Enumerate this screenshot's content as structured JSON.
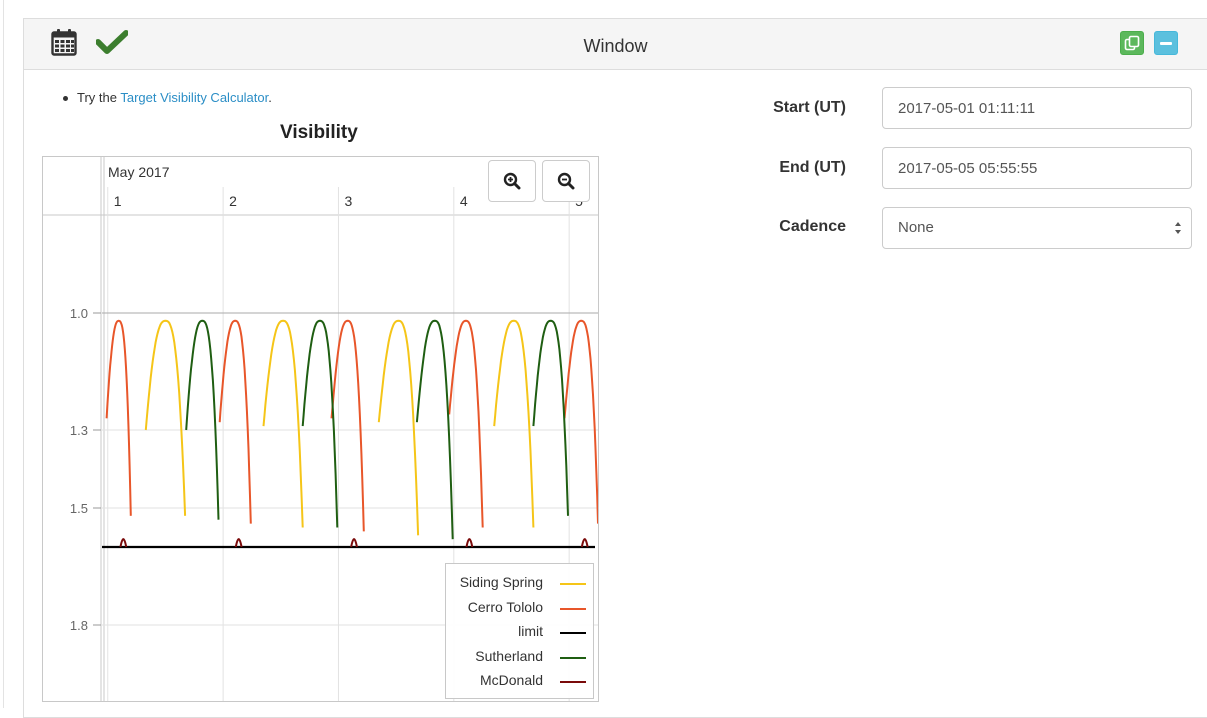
{
  "panel": {
    "title": "Window",
    "icons": [
      "calendar-icon",
      "checkmark-icon",
      "copy-icon",
      "minimize-icon"
    ],
    "colors": {
      "check": "#3c7e2e",
      "copy_button": "#5cb85c",
      "minimize_button": "#5bc0de",
      "link": "#2b8ec6"
    }
  },
  "intro": {
    "prefix": "Try the ",
    "link_text": "Target Visibility Calculator",
    "suffix": "."
  },
  "form": {
    "start_label": "Start (UT)",
    "start_value": "2017-05-01 01:11:11",
    "end_label": "End (UT)",
    "end_value": "2017-05-05 05:55:55",
    "cadence_label": "Cadence",
    "cadence_value": "None"
  },
  "zoom": {
    "in_icon": "zoom-in-icon",
    "out_icon": "zoom-out-icon"
  },
  "chart_data": {
    "type": "line",
    "title": "Visibility",
    "xlabel": "",
    "ylabel": "",
    "month_label": "May 2017",
    "x_ticks": [
      "1",
      "2",
      "3",
      "4",
      "5"
    ],
    "y_ticks": [
      "1.0",
      "1.3",
      "1.5",
      "1.8"
    ],
    "y_reversed": true,
    "xlim": [
      0.95,
      5.25
    ],
    "ylim": [
      1.0,
      2.0
    ],
    "limit": 1.6,
    "legend_position": "bottom-right",
    "grid": true,
    "series": [
      {
        "name": "Siding Spring",
        "color": "#f5c518",
        "arcs": [
          [
            1.33,
            1.67,
            1.3,
            1.52
          ],
          [
            2.35,
            2.69,
            1.29,
            1.55
          ],
          [
            3.35,
            3.69,
            1.28,
            1.57
          ],
          [
            4.35,
            4.69,
            1.29,
            1.55
          ]
        ]
      },
      {
        "name": "Cerro Tololo",
        "color": "#e8562a",
        "arcs": [
          [
            0.99,
            1.2,
            1.27,
            1.52
          ],
          [
            1.97,
            2.24,
            1.28,
            1.54
          ],
          [
            2.94,
            3.22,
            1.27,
            1.56
          ],
          [
            3.96,
            4.25,
            1.26,
            1.55
          ],
          [
            4.96,
            5.25,
            1.27,
            1.54
          ]
        ]
      },
      {
        "name": "limit",
        "color": "#000000",
        "value": 1.6
      },
      {
        "name": "Sutherland",
        "color": "#1f5e12",
        "arcs": [
          [
            1.68,
            1.96,
            1.3,
            1.53
          ],
          [
            2.69,
            2.99,
            1.29,
            1.55
          ],
          [
            3.68,
            3.99,
            1.28,
            1.58
          ],
          [
            4.69,
            4.99,
            1.29,
            1.52
          ]
        ]
      },
      {
        "name": "McDonald",
        "color": "#7a0a0a",
        "arcs": [
          [
            1.11,
            1.16,
            1.58,
            1.6
          ],
          [
            2.11,
            2.16,
            1.58,
            1.6
          ],
          [
            3.11,
            3.16,
            1.58,
            1.6
          ],
          [
            4.11,
            4.16,
            1.58,
            1.6
          ],
          [
            5.11,
            5.16,
            1.58,
            1.6
          ]
        ]
      }
    ]
  }
}
